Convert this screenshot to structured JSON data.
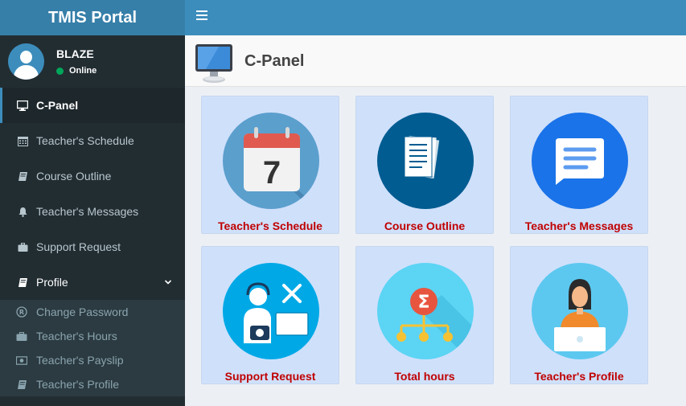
{
  "app": {
    "title": "TMIS Portal"
  },
  "user": {
    "name": "BLAZE",
    "status": "Online"
  },
  "sidebar": {
    "items": [
      {
        "label": "C-Panel",
        "icon": "monitor-icon"
      },
      {
        "label": "Teacher's Schedule",
        "icon": "calendar-icon"
      },
      {
        "label": "Course Outline",
        "icon": "book-icon"
      },
      {
        "label": "Teacher's Messages",
        "icon": "bell-icon"
      },
      {
        "label": "Support Request",
        "icon": "briefcase-icon"
      },
      {
        "label": "Profile",
        "icon": "book-icon"
      }
    ],
    "submenu": [
      {
        "label": "Change Password",
        "icon": "registered-icon"
      },
      {
        "label": "Teacher's Hours",
        "icon": "briefcase-icon"
      },
      {
        "label": "Teacher's Payslip",
        "icon": "money-icon"
      },
      {
        "label": "Teacher's Profile",
        "icon": "book-icon"
      }
    ]
  },
  "header": {
    "title": "C-Panel"
  },
  "tiles": [
    {
      "label": "Teacher's Schedule",
      "day": "7"
    },
    {
      "label": "Course Outline"
    },
    {
      "label": "Teacher's Messages"
    },
    {
      "label": "Support Request"
    },
    {
      "label": "Total hours",
      "symbol": "Σ"
    },
    {
      "label": "Teacher's Profile"
    }
  ],
  "colors": {
    "topbar": "#3c8dbc",
    "logo": "#367fa9",
    "sidebar": "#222d32",
    "tile_bg": "#cfe0fb",
    "tile_label": "#c00000"
  }
}
